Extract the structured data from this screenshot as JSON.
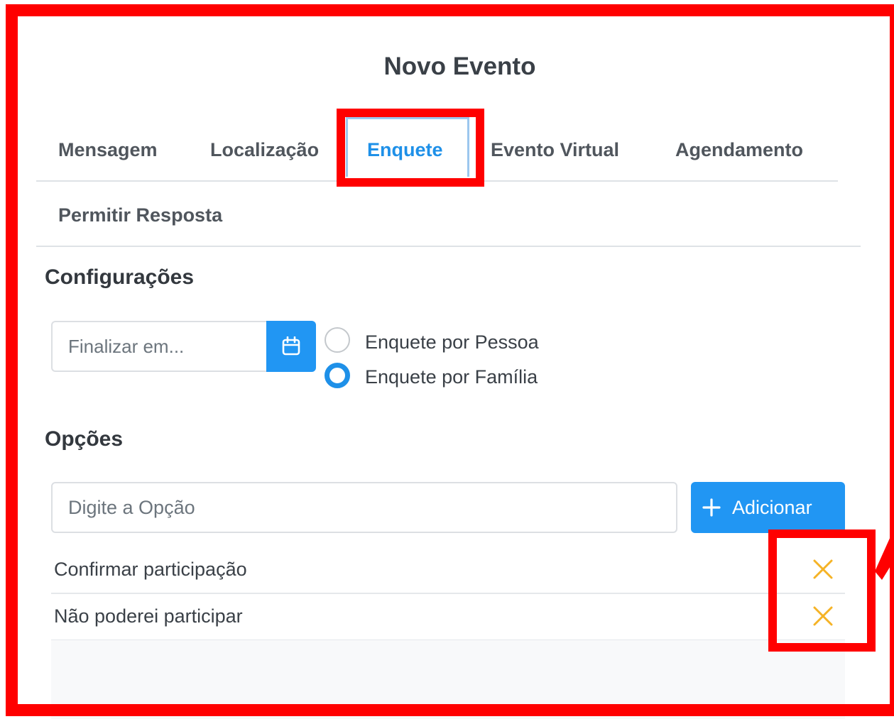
{
  "modal": {
    "title": "Novo Evento"
  },
  "tabs": [
    {
      "label": "Mensagem"
    },
    {
      "label": "Localização"
    },
    {
      "label": "Enquete",
      "active": true
    },
    {
      "label": "Evento Virtual"
    },
    {
      "label": "Agendamento"
    },
    {
      "label": "Permitir Resposta"
    }
  ],
  "config": {
    "title": "Configurações",
    "end_date_placeholder": "Finalizar em...",
    "calendar_icon": "calendar-icon",
    "radio_options": [
      {
        "label": "Enquete por Pessoa",
        "checked": false
      },
      {
        "label": "Enquete por Família",
        "checked": true
      }
    ]
  },
  "options": {
    "title": "Opções",
    "input_placeholder": "Digite a Opção",
    "add_label": "Adicionar",
    "items": [
      {
        "label": "Confirmar participação"
      },
      {
        "label": "Não poderei participar"
      }
    ]
  },
  "colors": {
    "primary": "#2196f3",
    "active_tab": "#1e90e8",
    "remove_icon": "#f5b326",
    "annotation": "#ff0000"
  }
}
